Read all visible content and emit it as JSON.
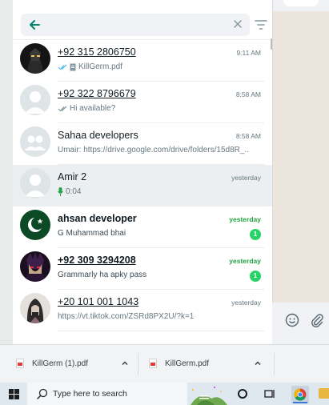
{
  "colors": {
    "accent_green": "#25d366",
    "time_green": "#25a244",
    "back_arrow": "#008069",
    "read_tick": "#53bdeb",
    "mic_green": "#25a244"
  },
  "search": {
    "back_icon": "arrow-left-icon",
    "clear_icon": "close-icon",
    "filter_icon": "filter-icon"
  },
  "chats": [
    {
      "name": "+92 315 2806750",
      "time": "9:11 AM",
      "preview": "KillGerm.pdf",
      "status_icon": "double-check-read-icon",
      "attachment_icon": "document-icon",
      "avatar": "dark-character-avatar"
    },
    {
      "name": "+92 322 8796679",
      "time": "8:58 AM",
      "preview": "Hi available?",
      "status_icon": "double-check-icon",
      "avatar": "default-user-avatar"
    },
    {
      "name": "Sahaa  developers",
      "time": "8:58 AM",
      "preview": "Umair: https://drive.google.com/drive/folders/15d8R_...",
      "avatar": "default-group-avatar"
    },
    {
      "name": "Amir 2",
      "time": "yesterday",
      "preview": "0:04",
      "status_icon": "mic-icon",
      "avatar": "default-user-avatar"
    },
    {
      "name": "ahsan developer",
      "time": "yesterday",
      "preview": "G Muhammad bhai",
      "unread": "1",
      "avatar": "pakistan-flag-avatar"
    },
    {
      "name": "+92 309 3294208",
      "time": "yesterday",
      "preview": "Grammarly ha apky pass",
      "unread": "1",
      "avatar": "red-eyed-character-avatar"
    },
    {
      "name": "+20 101 001 1043",
      "time": "yesterday",
      "preview": "https://vt.tiktok.com/ZSRd8PX2U/?k=1",
      "avatar": "hooded-figure-avatar"
    }
  ],
  "downloads": [
    {
      "filename": "KillGerm (1).pdf",
      "icon": "pdf-icon"
    },
    {
      "filename": "KillGerm.pdf",
      "icon": "pdf-icon"
    }
  ],
  "taskbar": {
    "search_placeholder": "Type here to search",
    "icons": [
      "windows-logo-icon",
      "search-icon",
      "cortana-icon",
      "task-view-icon",
      "chrome-icon",
      "file-explorer-icon"
    ]
  }
}
